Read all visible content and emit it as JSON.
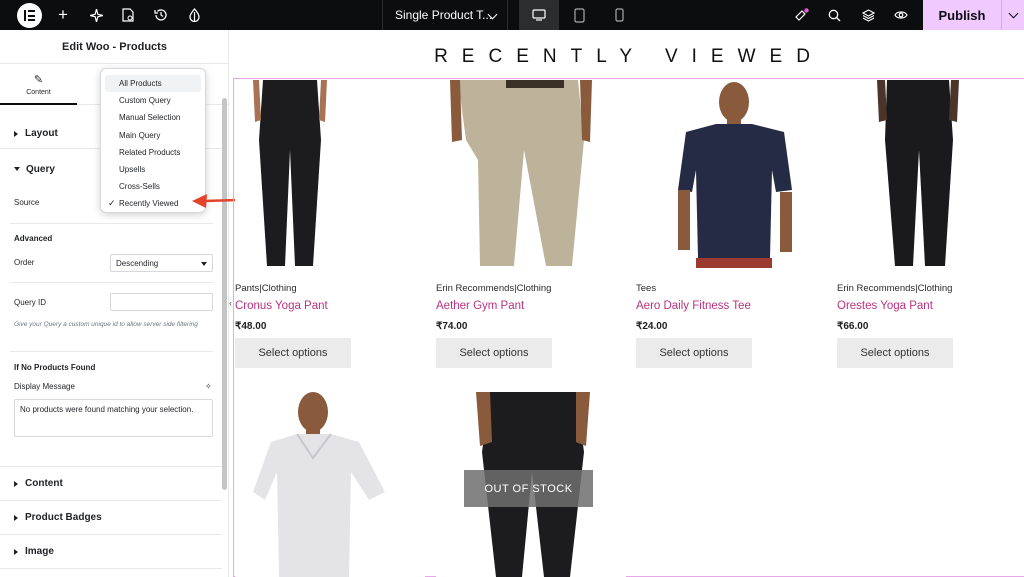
{
  "topbar": {
    "document_title": "Single Product T...",
    "publish_label": "Publish",
    "accent": "#f0c9ff"
  },
  "panel": {
    "title": "Edit Woo - Products",
    "tab_content": "Content",
    "sections": {
      "layout": "Layout",
      "query": "Query",
      "content": "Content",
      "badges": "Product Badges",
      "image": "Image"
    },
    "source_label": "Source",
    "advanced_label": "Advanced",
    "order_label": "Order",
    "order_value": "Descending",
    "query_id_label": "Query ID",
    "query_id_help": "Give your Query a custom unique id to allow server side filtering",
    "no_products_head": "If No Products Found",
    "display_message_label": "Display Message",
    "display_message_value": "No products were found matching your selection."
  },
  "dropdown": {
    "options": [
      "All Products",
      "Custom Query",
      "Manual Selection",
      "Main Query",
      "Related Products",
      "Upsells",
      "Cross-Sells",
      "Recently Viewed"
    ],
    "selected": "Recently Viewed"
  },
  "preview": {
    "heading": "RECENTLY VIEWED",
    "button_label": "Select options",
    "out_of_stock": "OUT OF STOCK",
    "products": [
      {
        "category": "Pants|Clothing",
        "name": "Cronus Yoga Pant",
        "price": "₹48.00"
      },
      {
        "category": "Erin Recommends|Clothing",
        "name": "Aether Gym Pant",
        "price": "₹74.00"
      },
      {
        "category": "Tees",
        "name": "Aero Daily Fitness Tee",
        "price": "₹24.00"
      },
      {
        "category": "Erin Recommends|Clothing",
        "name": "Orestes Yoga Pant",
        "price": "₹66.00"
      }
    ]
  }
}
